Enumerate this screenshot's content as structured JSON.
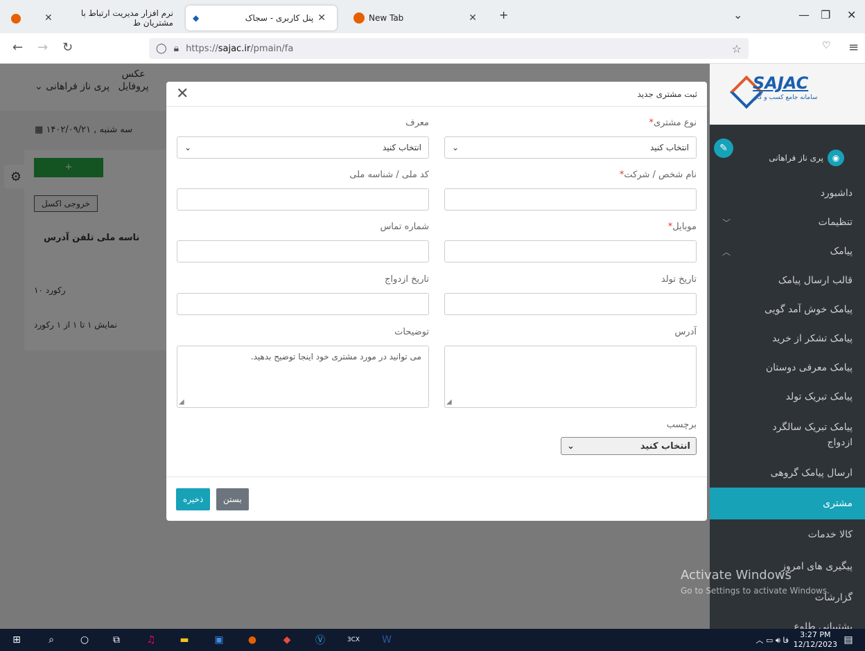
{
  "browser": {
    "tabs": [
      {
        "label": "نرم افزار مدیریت ارتباط با مشتریان ط",
        "active": false
      },
      {
        "label": "پنل کاربری - سجاک",
        "active": true
      },
      {
        "label": "New Tab",
        "active": false
      }
    ],
    "url_prefix": "https://",
    "url_domain": "sajac.ir",
    "url_path": "/pmain/fa"
  },
  "sidebar": {
    "logo_title": "SAJAC",
    "logo_sub": "سامانه جامع کسب و کار",
    "user_name": "پری ناز فراهانی",
    "items": [
      {
        "label": "داشبورد"
      },
      {
        "label": "تنظیمات"
      },
      {
        "label": "پیامک"
      },
      {
        "label": "قالب ارسال پیامک"
      },
      {
        "label": "پیامک خوش آمد گویی"
      },
      {
        "label": "پیامک تشکر از خرید"
      },
      {
        "label": "پیامک معرفی دوستان"
      },
      {
        "label": "پیامک تبریک تولد"
      },
      {
        "label": "پیامک تبریک سالگرد ازدواج"
      },
      {
        "label": "ارسال پیامک گروهی"
      },
      {
        "label": "مشتری"
      },
      {
        "label": "کالا خدمات"
      },
      {
        "label": "پیگیری های امروز"
      },
      {
        "label": "گزارشات"
      },
      {
        "label": "پشتیبانی طلوع"
      }
    ]
  },
  "background": {
    "profile_label": "عکس پروفایل",
    "profile_name": "پری ناز فراهانی",
    "date": "سه شنبه , ۱۴۰۲/۰۹/۲۱",
    "excel_btn": "خروجی اکسل",
    "table_headers": "ناسه ملی   تلفن   آدرس",
    "page_size": "۱۰",
    "records_label": "رکورد",
    "summary": "نمایش ۱ تا ۱ از ۱ رکورد"
  },
  "modal": {
    "title": "ثبت مشتری جدید",
    "customer_type_label": "نوع مشتری",
    "customer_type_value": "انتخاب کنید",
    "referrer_label": "معرف",
    "referrer_value": "انتخاب کنید",
    "name_label": "نام شخص / شرکت",
    "national_id_label": "کد ملی / شناسه ملی",
    "mobile_label": "موبایل",
    "phone_label": "شماره تماس",
    "birth_label": "تاریخ تولد",
    "marriage_label": "تاریخ ازدواج",
    "address_label": "آدرس",
    "desc_label": "توضیحات",
    "desc_placeholder": "می توانید در مورد مشتری خود اینجا توضیح بدهید.",
    "tag_label": "برچسب",
    "tag_value": "انتخاب کنید",
    "save": "ذخیره",
    "close": "بستن"
  },
  "watermark": {
    "line1": "Activate Windows",
    "line2": "Go to Settings to activate Windows."
  },
  "taskbar": {
    "time": "3:27 PM",
    "date": "12/12/2023",
    "lang": "فا"
  },
  "colors": {
    "accent": "#17a2b8",
    "sidebar": "#2e3338",
    "required": "#e3342f"
  }
}
